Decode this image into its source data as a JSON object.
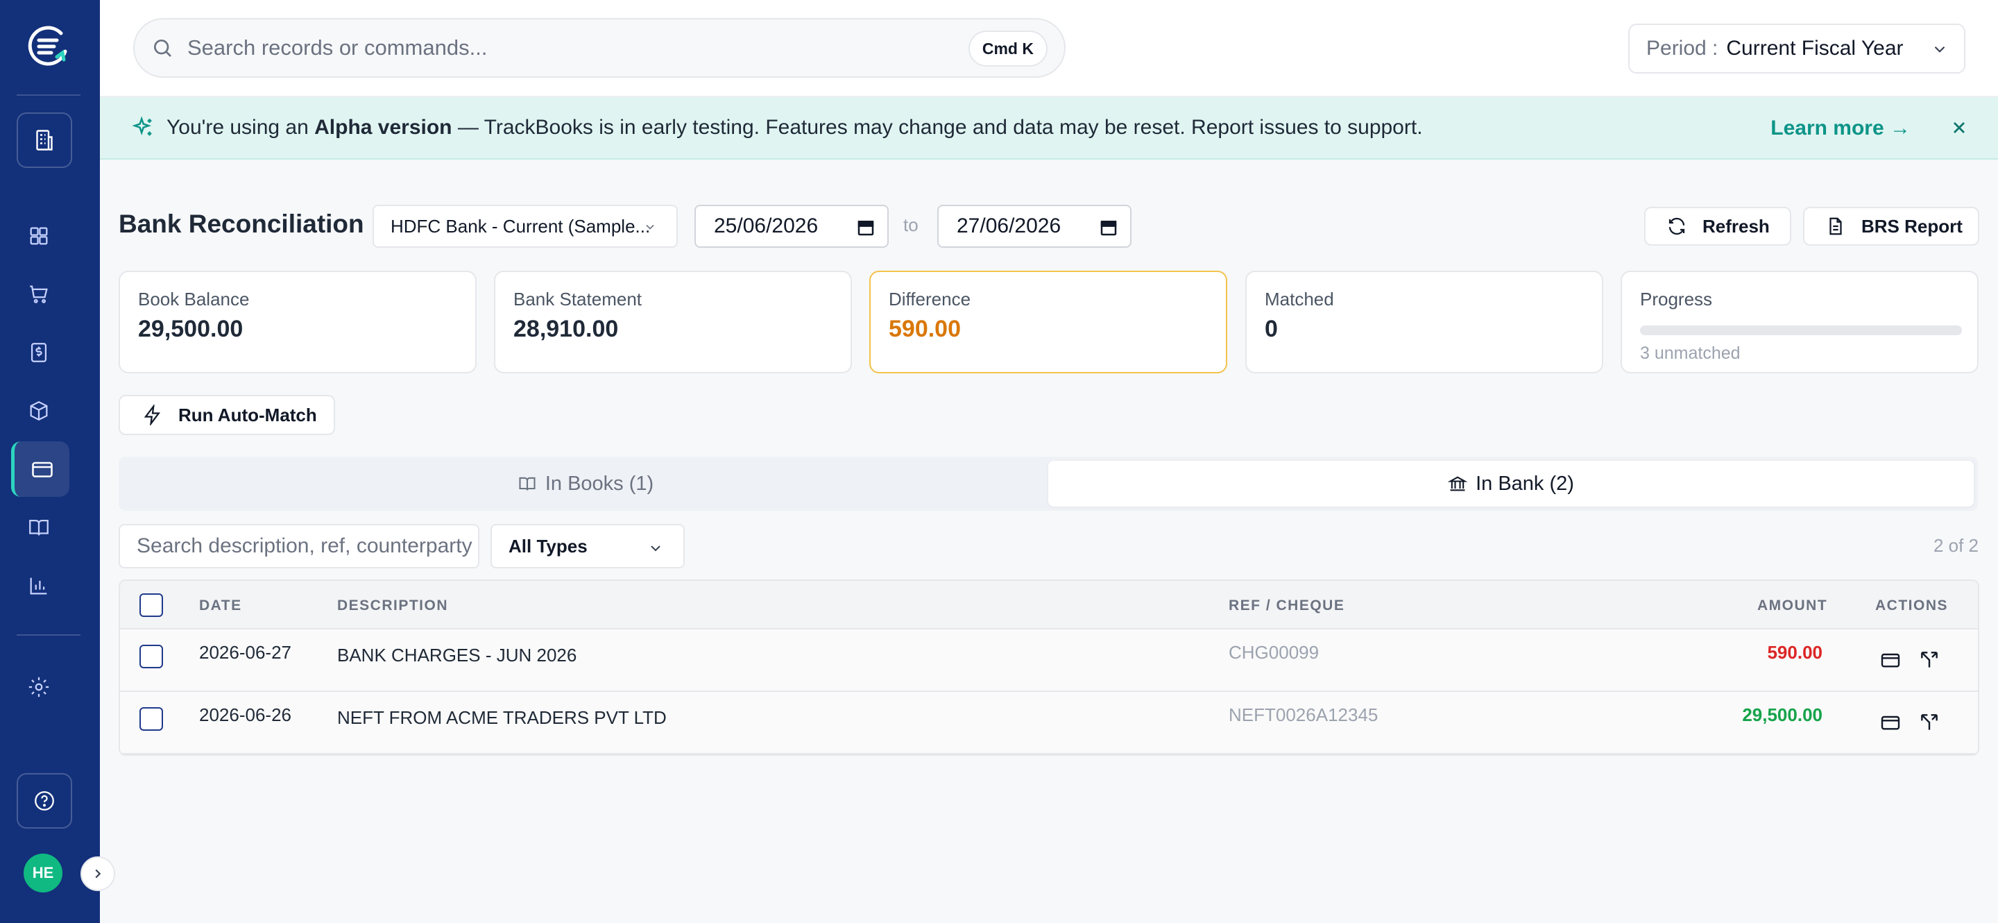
{
  "app": {
    "sidebar": {
      "avatar_initials": "HE",
      "items": [
        "dashboard",
        "purchases",
        "invoices",
        "inventory",
        "banking",
        "ledger",
        "reports"
      ]
    },
    "search": {
      "placeholder": "Search records or commands...",
      "shortcut": "Cmd K"
    },
    "period": {
      "label": "Period :",
      "value": "Current Fiscal Year"
    }
  },
  "banner": {
    "prefix": "You're using an ",
    "bold": "Alpha version",
    "suffix": " — TrackBooks is in early testing. Features may change and data may be reset. Report issues to support.",
    "link": "Learn more →"
  },
  "page": {
    "title": "Bank Reconciliation",
    "bank_account": "HDFC Bank - Current (Sample...",
    "date_from": "25/06/2026",
    "date_sep": "to",
    "date_to": "27/06/2026",
    "refresh_label": "Refresh",
    "report_label": "BRS Report",
    "automatch_label": "Run Auto-Match"
  },
  "stats": {
    "book_balance": {
      "label": "Book Balance",
      "value": "29,500.00"
    },
    "bank_statement": {
      "label": "Bank Statement",
      "value": "28,910.00"
    },
    "difference": {
      "label": "Difference",
      "value": "590.00"
    },
    "matched": {
      "label": "Matched",
      "value": "0"
    },
    "progress": {
      "label": "Progress",
      "fraction": 0,
      "sub": "3 unmatched"
    }
  },
  "tabs": [
    {
      "label": "In Books (1)",
      "active": false
    },
    {
      "label": "In Bank (2)",
      "active": true
    }
  ],
  "filters": {
    "search_placeholder": "Search description, ref, counterparty",
    "type": "All Types",
    "count": "2 of 2"
  },
  "table": {
    "headers": {
      "date": "DATE",
      "description": "DESCRIPTION",
      "ref": "REF / CHEQUE",
      "amount": "AMOUNT",
      "actions": "ACTIONS"
    },
    "rows": [
      {
        "date": "2026-06-27",
        "description": "BANK CHARGES - JUN 2026",
        "ref": "CHG00099",
        "amount": "590.00",
        "amount_color": "#dc2626"
      },
      {
        "date": "2026-06-26",
        "description": "NEFT FROM ACME TRADERS PVT LTD",
        "ref": "NEFT0026A12345",
        "amount": "29,500.00",
        "amount_color": "#16a34a"
      }
    ]
  },
  "colors": {
    "sidebar": "#13307a",
    "accent": "#0d9488",
    "warning": "#d97706",
    "debit": "#dc2626",
    "credit": "#16a34a"
  }
}
